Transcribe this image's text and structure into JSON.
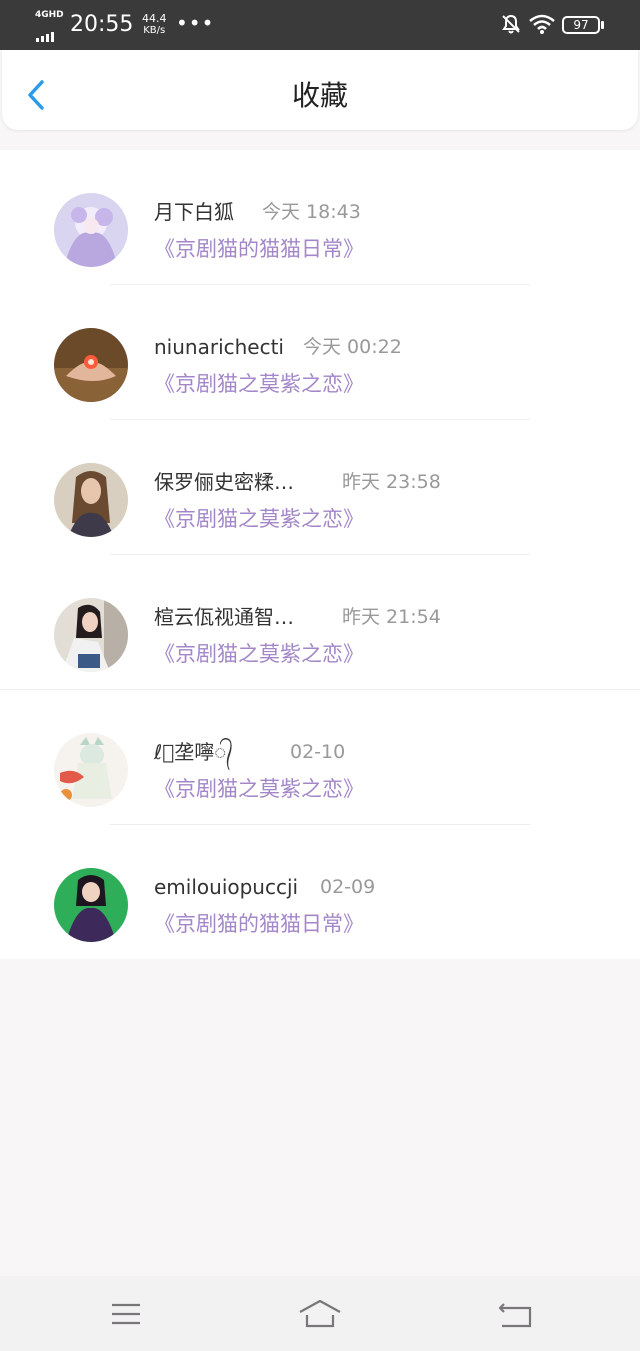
{
  "status_bar": {
    "network": "4GHD",
    "time": "20:55",
    "speed_value": "44.4",
    "speed_unit": "KB/s",
    "more": "•••",
    "battery": "97"
  },
  "header": {
    "title": "收藏",
    "back_icon": "chevron-left-icon"
  },
  "favorites": [
    {
      "name": "月下白狐",
      "time": "今天 18:43",
      "work": "《京剧猫的猫猫日常》",
      "avatar": "anime-girl-lavender"
    },
    {
      "name": "niunarichecti",
      "time": "今天 00:22",
      "work": "《京剧猫之莫紫之恋》",
      "avatar": "hands-glowing-light"
    },
    {
      "name": "保罗俪史密糅…",
      "time": "昨天 23:58",
      "work": "《京剧猫之莫紫之恋》",
      "avatar": "girl-long-hair"
    },
    {
      "name": "楦云佤视通智…",
      "time": "昨天 21:54",
      "work": "《京剧猫之莫紫之恋》",
      "avatar": "girl-sitting"
    },
    {
      "name": "ℓ᭄垄嚀᭄",
      "time": "02-10",
      "work": "《京剧猫之莫紫之恋》",
      "avatar": "anime-cat-girl"
    },
    {
      "name": "emilouiopuccji",
      "time": "02-09",
      "work": "《京剧猫的猫猫日常》",
      "avatar": "girl-green-background"
    }
  ],
  "nav": {
    "menu_icon": "menu-icon",
    "home_icon": "home-icon",
    "back_icon": "back-arrow-icon"
  },
  "colors": {
    "accent_back": "#2a9bea",
    "work_title": "#a387c9",
    "status_bar_bg": "#3a3a3a"
  }
}
